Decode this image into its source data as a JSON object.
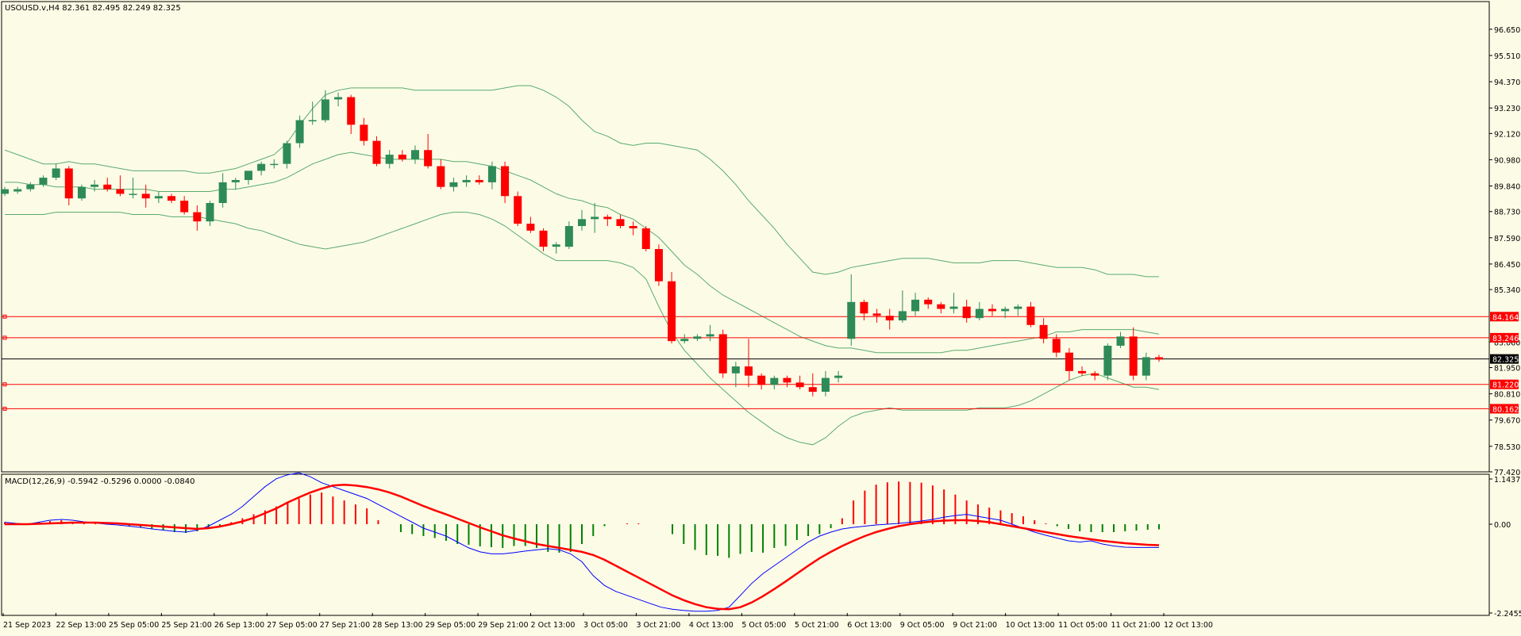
{
  "colors": {
    "background": "#fcfce6",
    "axis": "#000000",
    "bull": "#2e8b57",
    "bear": "#ff0000",
    "bollinger": "#5aaa6e",
    "level_line": "#ff0000",
    "level_label_bg": "#ff0000",
    "price_line": "#000000",
    "macd_line": "#0000ff",
    "signal_line": "#ff0000",
    "hist_pos": "#ff0000",
    "hist_neg": "#008000"
  },
  "chart_data": {
    "type": "candlestick",
    "header": "USOUSD.v,H4  82.361 82.495 82.249 82.325",
    "price_axis": {
      "ticks": [
        "96.650",
        "95.510",
        "94.370",
        "93.230",
        "92.120",
        "90.980",
        "89.840",
        "88.730",
        "87.590",
        "86.450",
        "85.340",
        "83.060",
        "81.950",
        "80.810",
        "79.670",
        "78.530",
        "77.420"
      ],
      "range": [
        77.42,
        97.3
      ]
    },
    "levels": [
      {
        "value": 84.164,
        "label": "84.164"
      },
      {
        "value": 83.246,
        "label": "83.246"
      },
      {
        "value": 81.22,
        "label": "81.220"
      },
      {
        "value": 80.162,
        "label": "80.162"
      }
    ],
    "current_price": {
      "value": 82.325,
      "label": "82.325"
    },
    "time_labels": [
      "21 Sep 2023",
      "22 Sep 13:00",
      "25 Sep 05:00",
      "25 Sep 21:00",
      "26 Sep 13:00",
      "27 Sep 05:00",
      "27 Sep 21:00",
      "28 Sep 13:00",
      "29 Sep 05:00",
      "29 Sep 21:00",
      "2 Oct 13:00",
      "3 Oct 05:00",
      "3 Oct 21:00",
      "4 Oct 13:00",
      "5 Oct 05:00",
      "5 Oct 21:00",
      "6 Oct 13:00",
      "9 Oct 05:00",
      "9 Oct 21:00",
      "10 Oct 13:00",
      "11 Oct 05:00",
      "11 Oct 21:00",
      "12 Oct 13:00"
    ],
    "candles": [
      [
        89.5,
        89.8,
        89.4,
        89.7
      ],
      [
        89.6,
        89.8,
        89.5,
        89.7
      ],
      [
        89.7,
        90.0,
        89.6,
        89.9
      ],
      [
        89.9,
        90.3,
        89.8,
        90.2
      ],
      [
        90.2,
        90.8,
        90.1,
        90.6
      ],
      [
        90.6,
        90.7,
        89.0,
        89.3
      ],
      [
        89.3,
        89.9,
        89.2,
        89.8
      ],
      [
        89.8,
        90.1,
        89.6,
        89.9
      ],
      [
        89.9,
        90.2,
        89.6,
        89.7
      ],
      [
        89.7,
        90.3,
        89.4,
        89.5
      ],
      [
        89.5,
        90.2,
        89.3,
        89.5
      ],
      [
        89.5,
        89.9,
        88.9,
        89.3
      ],
      [
        89.3,
        89.6,
        89.1,
        89.4
      ],
      [
        89.4,
        89.5,
        89.1,
        89.2
      ],
      [
        89.2,
        89.4,
        88.6,
        88.7
      ],
      [
        88.7,
        89.0,
        87.9,
        88.3
      ],
      [
        88.3,
        89.2,
        88.1,
        89.1
      ],
      [
        89.1,
        90.4,
        88.9,
        90.0
      ],
      [
        90.0,
        90.2,
        89.7,
        90.1
      ],
      [
        90.1,
        90.5,
        89.9,
        90.5
      ],
      [
        90.5,
        90.9,
        90.3,
        90.8
      ],
      [
        90.8,
        91.0,
        90.6,
        90.8
      ],
      [
        90.8,
        91.8,
        90.6,
        91.7
      ],
      [
        91.7,
        92.9,
        91.5,
        92.7
      ],
      [
        92.7,
        93.5,
        92.5,
        92.7
      ],
      [
        92.7,
        94.0,
        92.6,
        93.6
      ],
      [
        93.6,
        93.9,
        93.3,
        93.7
      ],
      [
        93.7,
        93.8,
        92.1,
        92.5
      ],
      [
        92.5,
        92.8,
        91.6,
        91.8
      ],
      [
        91.8,
        92.0,
        90.7,
        90.8
      ],
      [
        90.8,
        91.4,
        90.6,
        91.2
      ],
      [
        91.2,
        91.4,
        90.9,
        91.0
      ],
      [
        91.0,
        91.6,
        90.8,
        91.4
      ],
      [
        91.4,
        92.1,
        90.6,
        90.7
      ],
      [
        90.7,
        91.0,
        89.7,
        89.8
      ],
      [
        89.8,
        90.2,
        89.6,
        90.0
      ],
      [
        90.0,
        90.3,
        89.8,
        90.1
      ],
      [
        90.1,
        90.3,
        89.9,
        90.0
      ],
      [
        90.0,
        90.9,
        89.7,
        90.7
      ],
      [
        90.7,
        90.9,
        89.1,
        89.4
      ],
      [
        89.4,
        89.6,
        88.1,
        88.2
      ],
      [
        88.2,
        88.5,
        87.8,
        87.9
      ],
      [
        87.9,
        88.0,
        87.0,
        87.2
      ],
      [
        87.2,
        87.4,
        86.9,
        87.3
      ],
      [
        87.2,
        88.3,
        87.1,
        88.1
      ],
      [
        88.1,
        88.8,
        87.9,
        88.4
      ],
      [
        88.4,
        89.1,
        87.8,
        88.5
      ],
      [
        88.5,
        88.6,
        88.1,
        88.4
      ],
      [
        88.4,
        88.6,
        88.0,
        88.1
      ],
      [
        88.1,
        88.3,
        87.7,
        88.0
      ],
      [
        88.0,
        88.1,
        87.0,
        87.1
      ],
      [
        87.1,
        87.3,
        85.5,
        85.7
      ],
      [
        85.7,
        86.1,
        83.0,
        83.1
      ],
      [
        83.1,
        83.4,
        83.0,
        83.2
      ],
      [
        83.2,
        83.4,
        83.1,
        83.3
      ],
      [
        83.3,
        83.8,
        83.1,
        83.4
      ],
      [
        83.4,
        83.6,
        81.5,
        81.7
      ],
      [
        81.7,
        82.2,
        81.1,
        82.0
      ],
      [
        82.0,
        83.2,
        81.1,
        81.6
      ],
      [
        81.6,
        81.7,
        81.0,
        81.2
      ],
      [
        81.2,
        81.6,
        81.0,
        81.5
      ],
      [
        81.5,
        81.6,
        81.1,
        81.3
      ],
      [
        81.3,
        81.6,
        81.0,
        81.1
      ],
      [
        81.1,
        81.7,
        80.7,
        80.9
      ],
      [
        80.9,
        81.8,
        80.7,
        81.5
      ],
      [
        81.5,
        81.8,
        81.3,
        81.6
      ],
      [
        83.2,
        86.0,
        82.9,
        84.8
      ],
      [
        84.8,
        84.9,
        84.0,
        84.3
      ],
      [
        84.3,
        84.5,
        83.9,
        84.2
      ],
      [
        84.2,
        84.5,
        83.6,
        84.0
      ],
      [
        84.0,
        85.3,
        83.9,
        84.4
      ],
      [
        84.4,
        85.2,
        84.2,
        84.9
      ],
      [
        84.9,
        85.0,
        84.5,
        84.7
      ],
      [
        84.7,
        84.8,
        84.3,
        84.5
      ],
      [
        84.5,
        85.2,
        84.3,
        84.6
      ],
      [
        84.6,
        84.9,
        83.9,
        84.1
      ],
      [
        84.1,
        84.8,
        84.0,
        84.5
      ],
      [
        84.5,
        84.7,
        84.2,
        84.4
      ],
      [
        84.4,
        84.6,
        84.1,
        84.5
      ],
      [
        84.5,
        84.7,
        84.2,
        84.6
      ],
      [
        84.6,
        84.8,
        83.7,
        83.8
      ],
      [
        83.8,
        84.1,
        83.0,
        83.2
      ],
      [
        83.2,
        83.4,
        82.4,
        82.6
      ],
      [
        82.6,
        82.8,
        81.4,
        81.8
      ],
      [
        81.8,
        82.0,
        81.6,
        81.7
      ],
      [
        81.7,
        81.8,
        81.4,
        81.6
      ],
      [
        81.6,
        83.0,
        81.4,
        82.9
      ],
      [
        82.9,
        83.5,
        82.8,
        83.3
      ],
      [
        83.3,
        83.7,
        81.4,
        81.6
      ],
      [
        81.6,
        82.6,
        81.4,
        82.4
      ],
      [
        82.4,
        82.5,
        82.2,
        82.3
      ]
    ],
    "bollinger": {
      "upper": [
        91.4,
        91.2,
        91.0,
        90.8,
        90.8,
        90.9,
        90.8,
        90.8,
        90.7,
        90.6,
        90.5,
        90.5,
        90.5,
        90.5,
        90.5,
        90.4,
        90.4,
        90.5,
        90.6,
        90.8,
        91.0,
        91.2,
        91.7,
        92.5,
        93.2,
        93.8,
        94.0,
        94.1,
        94.1,
        94.1,
        94.1,
        94.1,
        94.0,
        94.0,
        94.0,
        94.0,
        94.0,
        94.0,
        94.0,
        94.1,
        94.2,
        94.2,
        94.0,
        93.7,
        93.3,
        92.7,
        92.2,
        92.0,
        91.7,
        91.6,
        91.7,
        91.7,
        91.6,
        91.5,
        91.4,
        91.0,
        90.5,
        89.9,
        89.2,
        88.6,
        88.0,
        87.3,
        86.7,
        86.1,
        86.0,
        86.1,
        86.3,
        86.4,
        86.5,
        86.6,
        86.7,
        86.7,
        86.7,
        86.6,
        86.5,
        86.5,
        86.5,
        86.6,
        86.6,
        86.6,
        86.5,
        86.4,
        86.3,
        86.3,
        86.3,
        86.2,
        86.0,
        86.0,
        86.0,
        85.9,
        85.9
      ],
      "middle": [
        90.0,
        90.0,
        89.9,
        89.9,
        89.8,
        89.8,
        89.8,
        89.7,
        89.7,
        89.7,
        89.7,
        89.7,
        89.6,
        89.6,
        89.6,
        89.6,
        89.6,
        89.7,
        89.7,
        89.8,
        89.9,
        90.0,
        90.2,
        90.5,
        90.8,
        91.0,
        91.2,
        91.3,
        91.2,
        91.1,
        91.0,
        91.0,
        91.0,
        91.0,
        91.0,
        90.9,
        90.9,
        90.8,
        90.7,
        90.5,
        90.3,
        90.1,
        89.8,
        89.5,
        89.3,
        89.2,
        89.0,
        88.9,
        88.6,
        88.4,
        88.0,
        87.6,
        87.0,
        86.4,
        86.0,
        85.5,
        85.1,
        84.8,
        84.5,
        84.2,
        83.9,
        83.6,
        83.3,
        83.1,
        82.9,
        82.8,
        82.8,
        82.7,
        82.6,
        82.6,
        82.6,
        82.6,
        82.6,
        82.6,
        82.7,
        82.7,
        82.8,
        82.9,
        83.0,
        83.1,
        83.2,
        83.3,
        83.5,
        83.5,
        83.6,
        83.6,
        83.6,
        83.6,
        83.6,
        83.5,
        83.4
      ],
      "lower": [
        88.6,
        88.6,
        88.6,
        88.6,
        88.7,
        88.7,
        88.7,
        88.7,
        88.7,
        88.7,
        88.6,
        88.6,
        88.6,
        88.5,
        88.5,
        88.5,
        88.4,
        88.3,
        88.2,
        88.0,
        87.9,
        87.7,
        87.5,
        87.3,
        87.2,
        87.1,
        87.2,
        87.3,
        87.4,
        87.6,
        87.8,
        88.0,
        88.2,
        88.4,
        88.6,
        88.7,
        88.7,
        88.6,
        88.4,
        88.1,
        87.7,
        87.3,
        86.9,
        86.6,
        86.6,
        86.6,
        86.6,
        86.6,
        86.5,
        86.3,
        85.8,
        84.6,
        83.5,
        82.7,
        82.1,
        81.5,
        81.0,
        80.5,
        80.0,
        79.6,
        79.2,
        78.9,
        78.7,
        78.6,
        78.9,
        79.4,
        79.8,
        80.0,
        80.1,
        80.2,
        80.1,
        80.1,
        80.1,
        80.1,
        80.1,
        80.1,
        80.2,
        80.2,
        80.2,
        80.3,
        80.5,
        80.8,
        81.1,
        81.4,
        81.6,
        81.7,
        81.5,
        81.3,
        81.1,
        81.1,
        81.0
      ]
    },
    "macd": {
      "header": "MACD(12,26,9) -0.5942 -0.5296 0.0000 -0.0840",
      "axis_ticks": [
        "1.1437",
        "0.00",
        "-2.2455"
      ],
      "range": [
        -2.2455,
        1.1437
      ],
      "histogram": [
        0.05,
        0.03,
        0.02,
        0.05,
        0.08,
        0.1,
        0.06,
        0.04,
        0.03,
        0.02,
        0.0,
        -0.05,
        -0.08,
        -0.12,
        -0.15,
        -0.2,
        -0.22,
        -0.18,
        -0.1,
        -0.05,
        0.05,
        0.15,
        0.25,
        0.35,
        0.45,
        0.55,
        0.65,
        0.75,
        0.8,
        0.7,
        0.6,
        0.5,
        0.4,
        0.1,
        0.0,
        -0.2,
        -0.25,
        -0.3,
        -0.35,
        -0.42,
        -0.5,
        -0.52,
        -0.56,
        -0.58,
        -0.6,
        -0.55,
        -0.55,
        -0.6,
        -0.7,
        -0.72,
        -0.7,
        -0.5,
        -0.3,
        -0.05,
        0.0,
        0.02,
        0.02,
        0.0,
        0.0,
        -0.25,
        -0.5,
        -0.65,
        -0.78,
        -0.8,
        -0.85,
        -0.75,
        -0.7,
        -0.72,
        -0.6,
        -0.55,
        -0.4,
        -0.3,
        -0.25,
        -0.1,
        0.15,
        0.6,
        0.85,
        1.0,
        1.06,
        1.08,
        1.07,
        1.05,
        0.98,
        0.88,
        0.75,
        0.6,
        0.5,
        0.42,
        0.35,
        0.28,
        0.2,
        0.1,
        0.02,
        -0.05,
        -0.12,
        -0.18,
        -0.2,
        -0.2,
        -0.2,
        -0.18,
        -0.16,
        -0.14,
        -0.13
      ],
      "macd_line": [
        0.05,
        0.02,
        0.0,
        0.05,
        0.1,
        0.12,
        0.1,
        0.06,
        0.03,
        0.0,
        -0.02,
        -0.05,
        -0.08,
        -0.12,
        -0.15,
        -0.18,
        -0.2,
        -0.15,
        -0.05,
        0.1,
        0.25,
        0.45,
        0.7,
        0.95,
        1.15,
        1.25,
        1.3,
        1.2,
        1.05,
        0.95,
        0.85,
        0.75,
        0.65,
        0.5,
        0.35,
        0.2,
        0.05,
        -0.1,
        -0.2,
        -0.3,
        -0.45,
        -0.6,
        -0.7,
        -0.75,
        -0.75,
        -0.72,
        -0.68,
        -0.65,
        -0.62,
        -0.65,
        -0.75,
        -0.95,
        -1.3,
        -1.55,
        -1.7,
        -1.8,
        -1.9,
        -2.0,
        -2.1,
        -2.15,
        -2.18,
        -2.2,
        -2.2,
        -2.18,
        -2.1,
        -1.8,
        -1.5,
        -1.25,
        -1.05,
        -0.85,
        -0.65,
        -0.45,
        -0.3,
        -0.2,
        -0.12,
        -0.08,
        -0.05,
        -0.02,
        0.0,
        0.02,
        0.05,
        0.08,
        0.12,
        0.18,
        0.22,
        0.25,
        0.2,
        0.15,
        0.1,
        0.0,
        -0.1,
        -0.2,
        -0.28,
        -0.35,
        -0.42,
        -0.45,
        -0.42,
        -0.5,
        -0.55,
        -0.58,
        -0.59,
        -0.59,
        -0.59
      ],
      "signal_line": [
        0.0,
        0.0,
        0.0,
        0.01,
        0.02,
        0.03,
        0.04,
        0.04,
        0.04,
        0.03,
        0.02,
        0.0,
        -0.02,
        -0.04,
        -0.06,
        -0.08,
        -0.1,
        -0.12,
        -0.1,
        -0.06,
        0.0,
        0.07,
        0.16,
        0.28,
        0.4,
        0.55,
        0.68,
        0.8,
        0.9,
        0.98,
        1.0,
        0.98,
        0.94,
        0.88,
        0.8,
        0.7,
        0.58,
        0.46,
        0.35,
        0.25,
        0.14,
        0.03,
        -0.08,
        -0.18,
        -0.28,
        -0.36,
        -0.43,
        -0.5,
        -0.55,
        -0.6,
        -0.65,
        -0.7,
        -0.78,
        -0.9,
        -1.05,
        -1.2,
        -1.35,
        -1.5,
        -1.65,
        -1.8,
        -1.92,
        -2.02,
        -2.1,
        -2.14,
        -2.15,
        -2.1,
        -1.98,
        -1.82,
        -1.64,
        -1.45,
        -1.25,
        -1.05,
        -0.86,
        -0.7,
        -0.55,
        -0.42,
        -0.3,
        -0.2,
        -0.12,
        -0.05,
        0.0,
        0.04,
        0.07,
        0.09,
        0.1,
        0.1,
        0.08,
        0.05,
        0.0,
        -0.05,
        -0.1,
        -0.15,
        -0.2,
        -0.25,
        -0.3,
        -0.34,
        -0.38,
        -0.42,
        -0.45,
        -0.48,
        -0.5,
        -0.52,
        -0.53
      ]
    }
  }
}
